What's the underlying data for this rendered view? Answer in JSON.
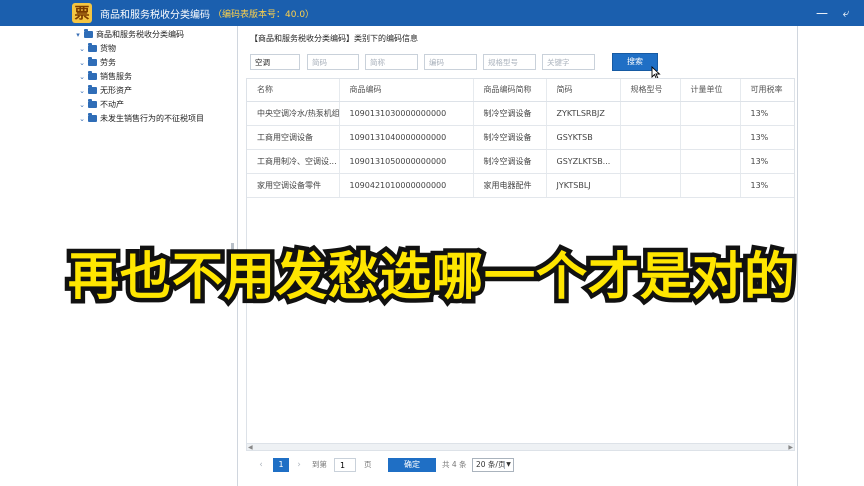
{
  "window": {
    "title": "商品和服务税收分类编码",
    "version": "（编码表版本号：40.0）",
    "logo_char": "票",
    "min_icon": "minimize-icon",
    "back_icon": "back-arrow-icon"
  },
  "tree": {
    "root": "商品和服务税收分类编码",
    "items": [
      "货物",
      "劳务",
      "销售服务",
      "无形资产",
      "不动产",
      "未发生销售行为的不征税项目"
    ]
  },
  "main": {
    "section_title": "【商品和服务税收分类编码】类别下的编码信息"
  },
  "search": {
    "field1_value": "空调",
    "field2_placeholder": "简码",
    "field3_placeholder": "简称",
    "field4_placeholder": "编码",
    "field5_placeholder": "规格型号",
    "field6_placeholder": "关键字",
    "button": "搜索"
  },
  "table": {
    "columns": [
      "名称",
      "商品编码",
      "商品编码简称",
      "简码",
      "规格型号",
      "计量单位",
      "可用税率"
    ],
    "rows": [
      [
        "中央空调冷水/热泵机组",
        "1090131030000000000",
        "制冷空调设备",
        "ZYKTLSRBJZ",
        "",
        "",
        "13%"
      ],
      [
        "工商用空调设备",
        "1090131040000000000",
        "制冷空调设备",
        "GSYKTSB",
        "",
        "",
        "13%"
      ],
      [
        "工商用制冷、空调设...",
        "1090131050000000000",
        "制冷空调设备",
        "GSYZLKTSB...",
        "",
        "",
        "13%"
      ],
      [
        "家用空调设备零件",
        "1090421010000000000",
        "家用电器配件",
        "JYKTSBLJ",
        "",
        "",
        "13%"
      ]
    ]
  },
  "pager": {
    "current_page": "1",
    "goto_label": "到第",
    "goto_value": "1",
    "page_unit": "页",
    "confirm": "确定",
    "total": "共 4 条",
    "page_size": "20 条/页"
  },
  "caption": "再也不用发愁选哪一个才是对的",
  "colors": {
    "titlebar": "#1b5fae",
    "accent": "#1f6fc5",
    "caption_fill": "#ffe600",
    "caption_stroke": "#111111"
  }
}
